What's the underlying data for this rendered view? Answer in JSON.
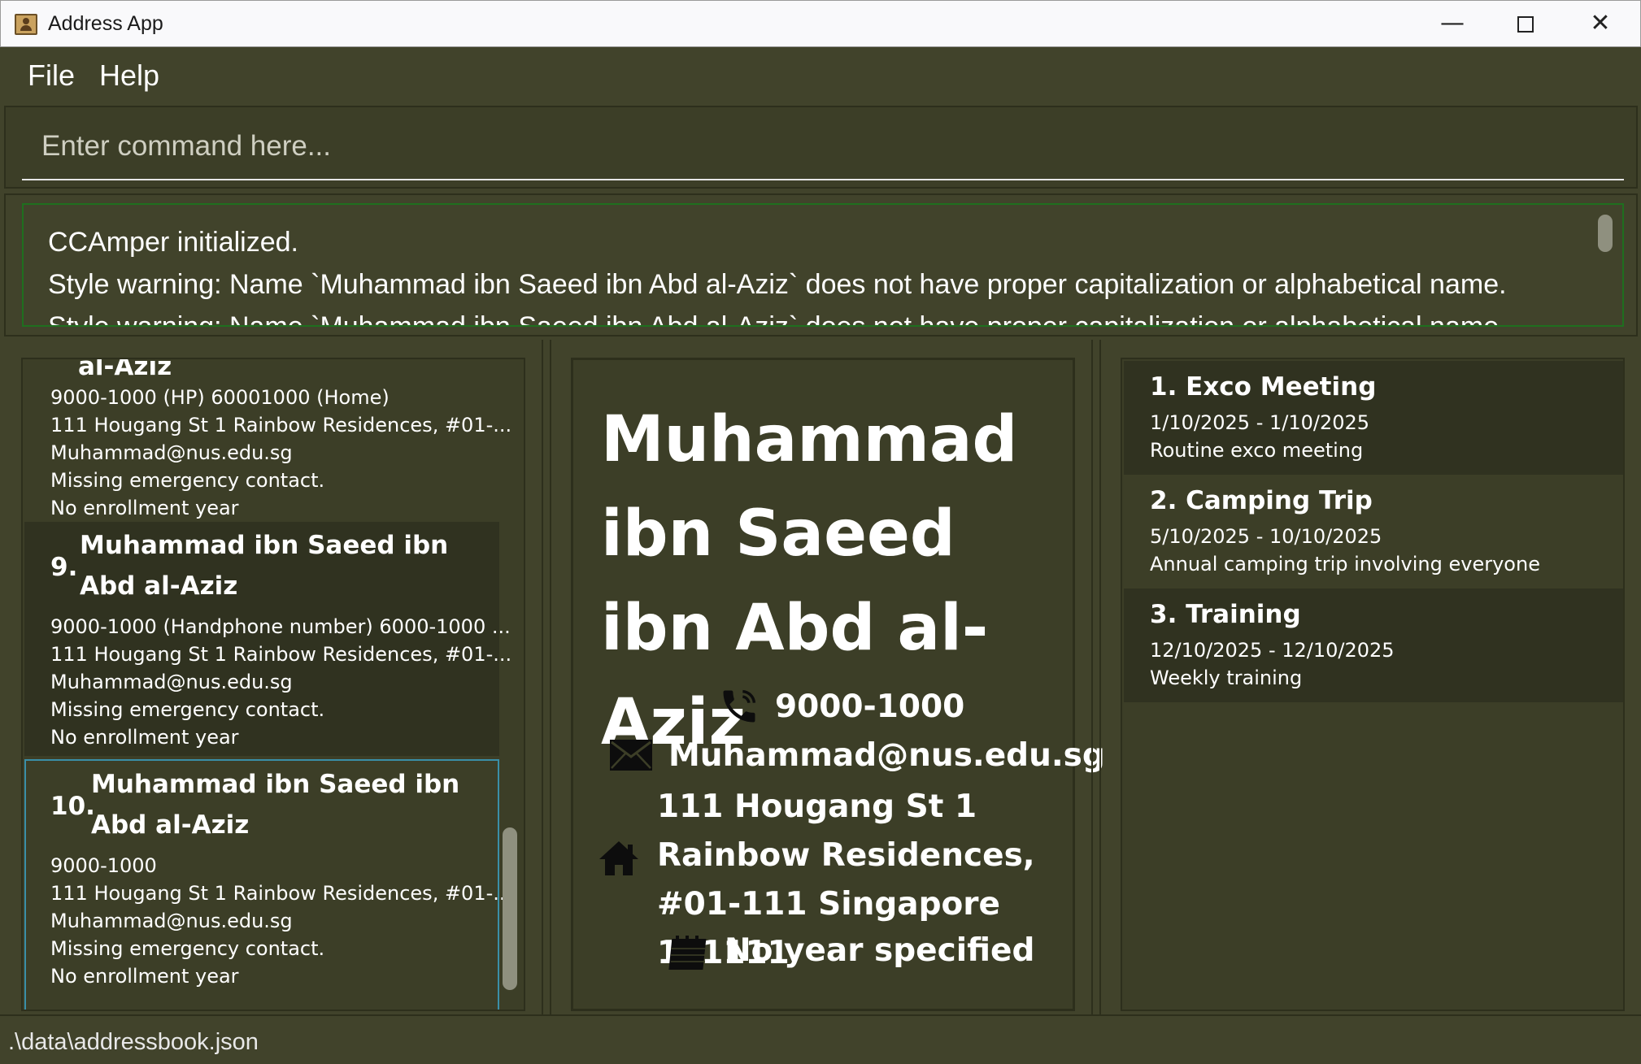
{
  "window": {
    "title": "Address App",
    "minimize": "—",
    "close": "✕"
  },
  "menu": {
    "file": "File",
    "help": "Help"
  },
  "command": {
    "placeholder": "Enter command here..."
  },
  "result": {
    "lines": [
      "CCAmper initialized.",
      "Style warning: Name `Muhammad ibn Saeed ibn Abd al-Aziz` does not have proper capitalization or alphabetical name.",
      "Style warning: Name `Muhammad ibn Saeed ibn Abd al-Aziz` does not have proper capitalization or alphabetical name."
    ]
  },
  "person_list": {
    "cards": [
      {
        "name_tail": "al-Aziz",
        "phone": "9000-1000 (HP) 60001000 (Home)",
        "address": "111 Hougang St 1 Rainbow Residences, #01-...",
        "email": "Muhammad@nus.edu.sg",
        "emergency": "Missing emergency contact.",
        "year": "No enrollment year"
      },
      {
        "index": "9.",
        "name": "Muhammad ibn Saeed ibn Abd al-Aziz",
        "phone": "9000-1000 (Handphone number) 6000-1000 ...",
        "address": "111 Hougang St 1 Rainbow Residences, #01-...",
        "email": "Muhammad@nus.edu.sg",
        "emergency": "Missing emergency contact.",
        "year": "No enrollment year"
      },
      {
        "index": "10.",
        "name": "Muhammad ibn Saeed ibn Abd al-Aziz",
        "phone": "9000-1000",
        "address": "111 Hougang St 1 Rainbow Residences, #01-...",
        "email": "Muhammad@nus.edu.sg",
        "emergency": "Missing emergency contact.",
        "year": "No enrollment year"
      }
    ]
  },
  "detail": {
    "name": "Muhammad ibn Saeed ibn Abd al-Aziz",
    "phone": "9000-1000",
    "email": "Muhammad@nus.edu.sg",
    "address": "111 Hougang St 1 Rainbow Residences, #01-111 Singapore 111111",
    "year": "No year specified"
  },
  "events": [
    {
      "title": "1. Exco Meeting",
      "date": "1/10/2025 - 1/10/2025",
      "desc": "Routine exco meeting"
    },
    {
      "title": "2. Camping Trip",
      "date": "5/10/2025 - 10/10/2025",
      "desc": "Annual camping trip involving everyone"
    },
    {
      "title": "3. Training",
      "date": "12/10/2025 - 12/10/2025",
      "desc": "Weekly training"
    }
  ],
  "status": {
    "path": ".\\data\\addressbook.json"
  },
  "colors": {
    "background": "#41432b",
    "panel": "#3c3e27",
    "card_dark": "#303220",
    "selected_border": "#3a8fa8",
    "result_border": "#1f6f1f"
  },
  "icons": {
    "phone": "phone-icon",
    "email": "envelope-icon",
    "address": "home-icon",
    "year": "calendar-icon"
  }
}
